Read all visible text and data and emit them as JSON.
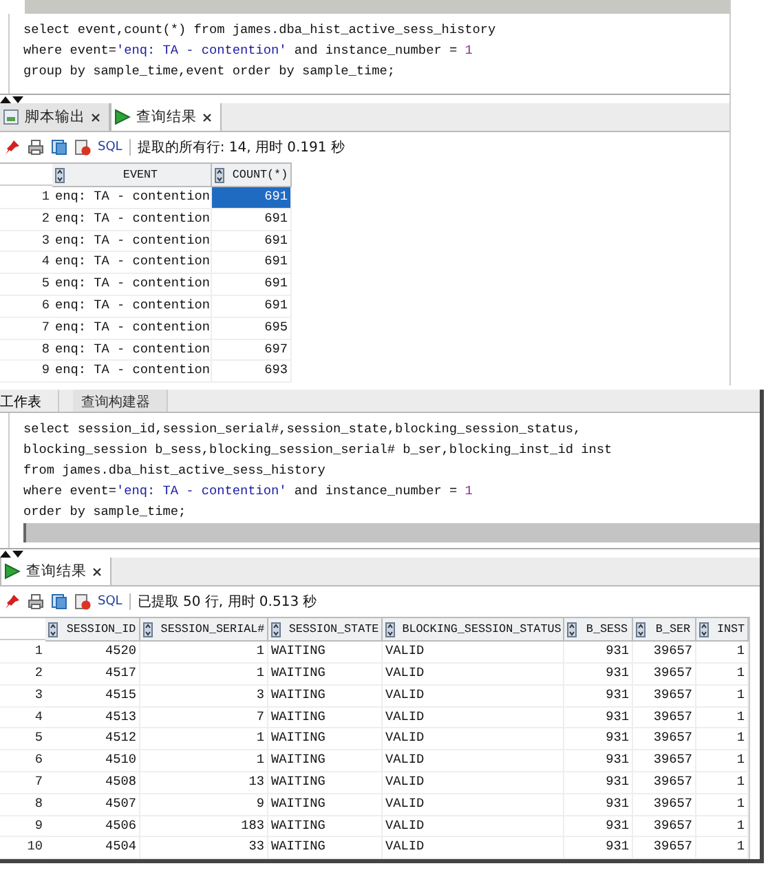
{
  "panels": [
    {
      "editor": {
        "lines": [
          [
            {
              "kind": "text",
              "text": "select event,count(*) from james.dba_hist_active_sess_history"
            }
          ],
          [
            {
              "kind": "text",
              "text": "where event="
            },
            {
              "kind": "string",
              "text": "'enq: TA - contention'"
            },
            {
              "kind": "text",
              "text": " and instance_number = "
            },
            {
              "kind": "number",
              "text": "1"
            }
          ],
          [
            {
              "kind": "text",
              "text": "group by sample_time,event order by sample_time;"
            }
          ]
        ]
      },
      "result_tabs": [
        {
          "label": "脚本输出",
          "kind": "output",
          "selected": false
        },
        {
          "label": "查询结果",
          "kind": "results",
          "selected": true
        }
      ],
      "toolbar": {
        "sql": "SQL",
        "status": "提取的所有行: 14, 用时 0.191 秒"
      },
      "grid": {
        "columns": [
          {
            "title": "EVENT",
            "kind": "text"
          },
          {
            "title": "COUNT(*)",
            "kind": "number"
          }
        ],
        "rows": [
          {
            "number": "1",
            "cells": [
              "enq: TA - contention",
              "691"
            ],
            "selected": [
              false,
              true
            ]
          },
          {
            "number": "2",
            "cells": [
              "enq: TA - contention",
              "691"
            ],
            "selected": [
              false,
              false
            ]
          },
          {
            "number": "3",
            "cells": [
              "enq: TA - contention",
              "691"
            ],
            "selected": [
              false,
              false
            ]
          },
          {
            "number": "4",
            "cells": [
              "enq: TA - contention",
              "691"
            ],
            "selected": [
              false,
              false
            ]
          },
          {
            "number": "5",
            "cells": [
              "enq: TA - contention",
              "691"
            ],
            "selected": [
              false,
              false
            ]
          },
          {
            "number": "6",
            "cells": [
              "enq: TA - contention",
              "691"
            ],
            "selected": [
              false,
              false
            ]
          },
          {
            "number": "7",
            "cells": [
              "enq: TA - contention",
              "695"
            ],
            "selected": [
              false,
              false
            ]
          },
          {
            "number": "8",
            "cells": [
              "enq: TA - contention",
              "697"
            ],
            "selected": [
              false,
              false
            ]
          },
          {
            "number": "9",
            "cells": [
              "enq: TA - contention",
              "693"
            ],
            "selected": [
              false,
              false
            ]
          }
        ]
      }
    },
    {
      "editor_tabs": [
        {
          "label": "工作表",
          "selected": true
        },
        {
          "label": "查询构建器",
          "selected": false
        }
      ],
      "editor": {
        "lines": [
          [
            {
              "kind": "text",
              "text": "select session_id,session_serial#,session_state,blocking_session_status,"
            }
          ],
          [
            {
              "kind": "text",
              "text": "blocking_session b_sess,blocking_session_serial# b_ser,blocking_inst_id inst"
            }
          ],
          [
            {
              "kind": "text",
              "text": "from james.dba_hist_active_sess_history"
            }
          ],
          [
            {
              "kind": "text",
              "text": "where event="
            },
            {
              "kind": "string",
              "text": "'enq: TA - contention'"
            },
            {
              "kind": "text",
              "text": " and instance_number = "
            },
            {
              "kind": "number",
              "text": "1"
            }
          ],
          [
            {
              "kind": "text",
              "text": "order by sample_time;"
            }
          ]
        ],
        "cursor_line": true
      },
      "result_tabs": [
        {
          "label": "查询结果",
          "kind": "results",
          "selected": true
        }
      ],
      "toolbar": {
        "sql": "SQL",
        "status": "已提取 50 行, 用时 0.513 秒"
      },
      "grid": {
        "columns": [
          {
            "title": "SESSION_ID",
            "kind": "number"
          },
          {
            "title": "SESSION_SERIAL#",
            "kind": "number"
          },
          {
            "title": "SESSION_STATE",
            "kind": "text"
          },
          {
            "title": "BLOCKING_SESSION_STATUS",
            "kind": "text"
          },
          {
            "title": "B_SESS",
            "kind": "number"
          },
          {
            "title": "B_SER",
            "kind": "number"
          },
          {
            "title": "INST",
            "kind": "number"
          }
        ],
        "rows": [
          {
            "number": "1",
            "cells": [
              "4520",
              "1",
              "WAITING",
              "VALID",
              "931",
              "39657",
              "1"
            ]
          },
          {
            "number": "2",
            "cells": [
              "4517",
              "1",
              "WAITING",
              "VALID",
              "931",
              "39657",
              "1"
            ]
          },
          {
            "number": "3",
            "cells": [
              "4515",
              "3",
              "WAITING",
              "VALID",
              "931",
              "39657",
              "1"
            ]
          },
          {
            "number": "4",
            "cells": [
              "4513",
              "7",
              "WAITING",
              "VALID",
              "931",
              "39657",
              "1"
            ]
          },
          {
            "number": "5",
            "cells": [
              "4512",
              "1",
              "WAITING",
              "VALID",
              "931",
              "39657",
              "1"
            ]
          },
          {
            "number": "6",
            "cells": [
              "4510",
              "1",
              "WAITING",
              "VALID",
              "931",
              "39657",
              "1"
            ]
          },
          {
            "number": "7",
            "cells": [
              "4508",
              "13",
              "WAITING",
              "VALID",
              "931",
              "39657",
              "1"
            ]
          },
          {
            "number": "8",
            "cells": [
              "4507",
              "9",
              "WAITING",
              "VALID",
              "931",
              "39657",
              "1"
            ]
          },
          {
            "number": "9",
            "cells": [
              "4506",
              "183",
              "WAITING",
              "VALID",
              "931",
              "39657",
              "1"
            ]
          },
          {
            "number": "10",
            "cells": [
              "4504",
              "33",
              "WAITING",
              "VALID",
              "931",
              "39657",
              "1"
            ]
          }
        ]
      }
    }
  ]
}
